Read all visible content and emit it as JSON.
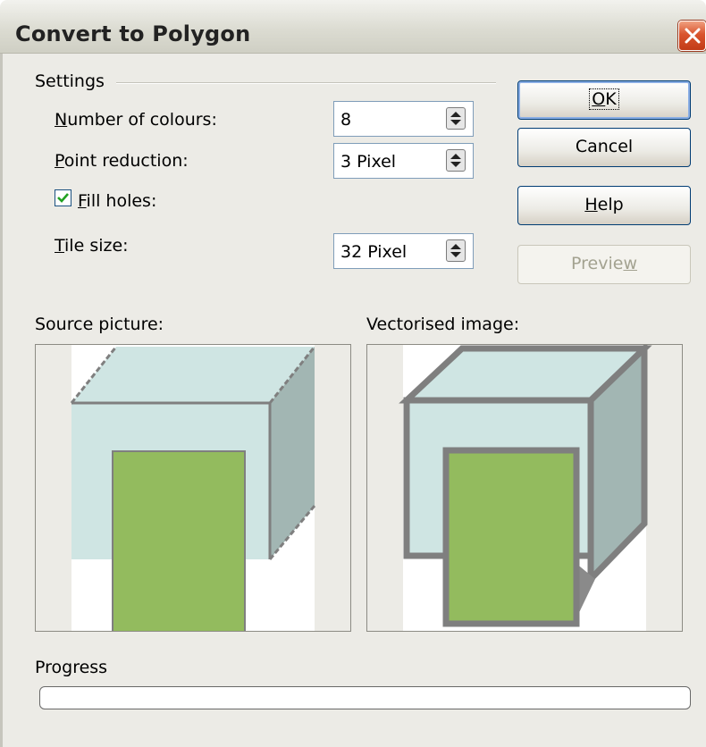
{
  "window": {
    "title": "Convert to Polygon"
  },
  "settings": {
    "group_label": "Settings",
    "colours": {
      "label_u": "N",
      "label_rest": "umber of colours:",
      "value": "8"
    },
    "point": {
      "label_u": "P",
      "label_rest": "oint reduction:",
      "value": "3 Pixel"
    },
    "fill": {
      "label_u": "F",
      "label_rest": "ill holes:",
      "checked": true
    },
    "tile": {
      "label_u": "T",
      "label_rest": "ile size:",
      "value": "32 Pixel"
    }
  },
  "buttons": {
    "ok": {
      "label_u": "O",
      "label_rest": "K"
    },
    "cancel": {
      "label": "Cancel"
    },
    "help": {
      "label_u": "H",
      "label_rest": "elp"
    },
    "preview": {
      "label_pre": "Previe",
      "label_u": "w",
      "enabled": false
    }
  },
  "panes": {
    "source_label": "Source picture:",
    "vector_label": "Vectorised image:"
  },
  "progress": {
    "label": "Progress",
    "value": 0
  },
  "colors": {
    "cube_front": "#cfe5e3",
    "cube_side": "#a2b6b3",
    "door": "#93bb5e",
    "outline": "#7f7f7f"
  },
  "icons": {
    "close": "close-x-icon",
    "spin": "spin-arrows-icon",
    "check": "checkmark-icon"
  }
}
